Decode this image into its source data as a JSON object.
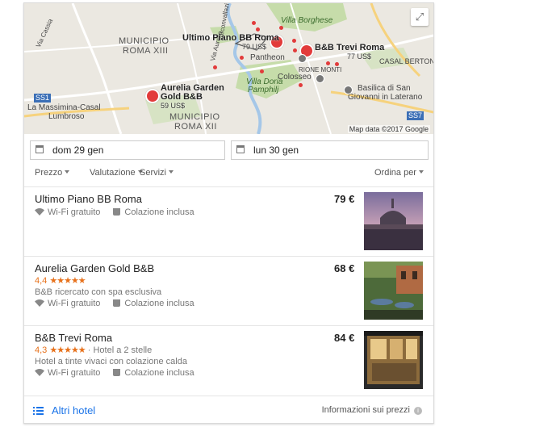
{
  "map": {
    "area_labels": [
      "MUNICIPIO",
      "ROMA XIII",
      "MUNICIPIO",
      "ROMA XII"
    ],
    "place_labels": [
      "Villa Borghese",
      "Pantheon",
      "Colosseo",
      "Villa Doria",
      "Pamphilj",
      "Basilica di San",
      "Giovanni in Laterano",
      "La Massimina-Casal",
      "Lumbroso",
      "CASAL BERTONE",
      "RIONE MONTI",
      "Via Aurelia",
      "Via Cassia",
      "SS1",
      "SS7",
      "Circonvallazione Gianicolense"
    ],
    "hotels": [
      {
        "name": "Ultimo Piano BB Roma",
        "price": "79 US$"
      },
      {
        "name": "B&B Trevi Roma",
        "price": "77 US$"
      },
      {
        "name": "Aurelia Garden\nGold B&B",
        "name_line1": "Aurelia Garden",
        "name_line2": "Gold B&B",
        "price": "59 US$"
      }
    ],
    "attribution": "Map data ©2017 Google",
    "expand_icon": "expand-icon"
  },
  "dates": {
    "checkin": "dom 29 gen",
    "checkout": "lun 30 gen"
  },
  "filters": {
    "price": "Prezzo",
    "rating": "Valutazione",
    "services": "Servizi",
    "sort": "Ordina per"
  },
  "results": [
    {
      "name": "Ultimo Piano BB Roma",
      "price": "79 €",
      "wifi": "Wi-Fi gratuito",
      "breakfast": "Colazione inclusa"
    },
    {
      "name": "Aurelia Garden Gold B&B",
      "price": "68 €",
      "rating": "4,4",
      "stars": "★★★★★",
      "stars_value": 4.4,
      "description": "B&B ricercato con spa esclusiva",
      "wifi": "Wi-Fi gratuito",
      "breakfast": "Colazione inclusa"
    },
    {
      "name": "B&B Trevi Roma",
      "price": "84 €",
      "rating": "4,3",
      "stars": "★★★★★",
      "stars_value": 4.3,
      "hotel_class": "· Hotel a 2 stelle",
      "description": "Hotel a tinte vivaci con colazione calda",
      "wifi": "Wi-Fi gratuito",
      "breakfast": "Colazione inclusa"
    }
  ],
  "footer": {
    "more_hotels": "Altri hotel",
    "price_info": "Informazioni sui prezzi",
    "info_glyph": "i"
  },
  "colors": {
    "accent": "#1a73e8",
    "rating": "#e7711b",
    "pin": "#e23b3b"
  }
}
